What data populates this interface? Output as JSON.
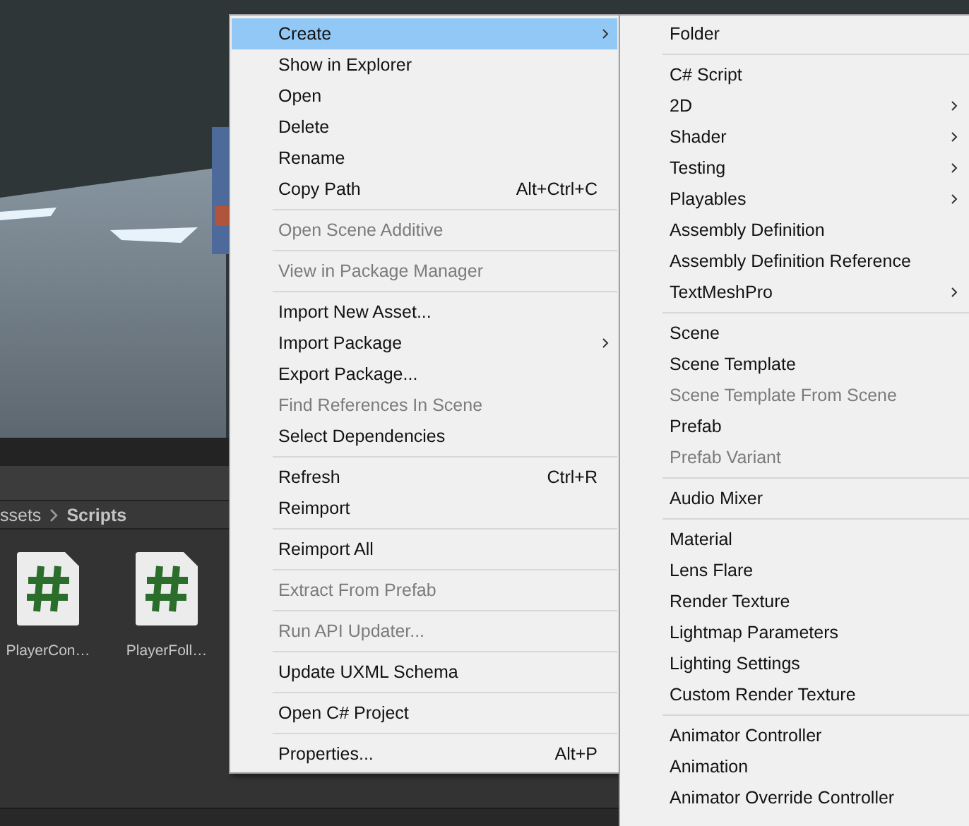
{
  "project_panel": {
    "breadcrumb": [
      {
        "label": "ssets",
        "current": false
      },
      {
        "label": "Scripts",
        "current": true
      }
    ],
    "files": [
      {
        "name": "PlayerCon…",
        "kind": "script"
      },
      {
        "name": "PlayerFoll…",
        "kind": "script"
      }
    ]
  },
  "context_menu": {
    "groups": [
      [
        {
          "label": "Create",
          "disabled": false,
          "submenu": true,
          "selected": true
        },
        {
          "label": "Show in Explorer",
          "disabled": false,
          "submenu": false,
          "selected": false
        },
        {
          "label": "Open",
          "disabled": false,
          "submenu": false,
          "selected": false
        },
        {
          "label": "Delete",
          "disabled": false,
          "submenu": false,
          "selected": false
        },
        {
          "label": "Rename",
          "disabled": false,
          "submenu": false,
          "selected": false
        },
        {
          "label": "Copy Path",
          "shortcut": "Alt+Ctrl+C",
          "disabled": false,
          "submenu": false,
          "selected": false
        }
      ],
      [
        {
          "label": "Open Scene Additive",
          "disabled": true,
          "submenu": false,
          "selected": false
        }
      ],
      [
        {
          "label": "View in Package Manager",
          "disabled": true,
          "submenu": false,
          "selected": false
        }
      ],
      [
        {
          "label": "Import New Asset...",
          "disabled": false,
          "submenu": false,
          "selected": false
        },
        {
          "label": "Import Package",
          "disabled": false,
          "submenu": true,
          "selected": false
        },
        {
          "label": "Export Package...",
          "disabled": false,
          "submenu": false,
          "selected": false
        },
        {
          "label": "Find References In Scene",
          "disabled": true,
          "submenu": false,
          "selected": false
        },
        {
          "label": "Select Dependencies",
          "disabled": false,
          "submenu": false,
          "selected": false
        }
      ],
      [
        {
          "label": "Refresh",
          "shortcut": "Ctrl+R",
          "disabled": false,
          "submenu": false,
          "selected": false
        },
        {
          "label": "Reimport",
          "disabled": false,
          "submenu": false,
          "selected": false
        }
      ],
      [
        {
          "label": "Reimport All",
          "disabled": false,
          "submenu": false,
          "selected": false
        }
      ],
      [
        {
          "label": "Extract From Prefab",
          "disabled": true,
          "submenu": false,
          "selected": false
        }
      ],
      [
        {
          "label": "Run API Updater...",
          "disabled": true,
          "submenu": false,
          "selected": false
        }
      ],
      [
        {
          "label": "Update UXML Schema",
          "disabled": false,
          "submenu": false,
          "selected": false
        }
      ],
      [
        {
          "label": "Open C# Project",
          "disabled": false,
          "submenu": false,
          "selected": false
        }
      ],
      [
        {
          "label": "Properties...",
          "shortcut": "Alt+P",
          "disabled": false,
          "submenu": false,
          "selected": false
        }
      ]
    ]
  },
  "create_submenu": {
    "groups": [
      [
        {
          "label": "Folder",
          "disabled": false,
          "submenu": false
        }
      ],
      [
        {
          "label": "C# Script",
          "disabled": false,
          "submenu": false
        },
        {
          "label": "2D",
          "disabled": false,
          "submenu": true
        },
        {
          "label": "Shader",
          "disabled": false,
          "submenu": true
        },
        {
          "label": "Testing",
          "disabled": false,
          "submenu": true
        },
        {
          "label": "Playables",
          "disabled": false,
          "submenu": true
        },
        {
          "label": "Assembly Definition",
          "disabled": false,
          "submenu": false
        },
        {
          "label": "Assembly Definition Reference",
          "disabled": false,
          "submenu": false
        },
        {
          "label": "TextMeshPro",
          "disabled": false,
          "submenu": true
        }
      ],
      [
        {
          "label": "Scene",
          "disabled": false,
          "submenu": false
        },
        {
          "label": "Scene Template",
          "disabled": false,
          "submenu": false
        },
        {
          "label": "Scene Template From Scene",
          "disabled": true,
          "submenu": false
        },
        {
          "label": "Prefab",
          "disabled": false,
          "submenu": false
        },
        {
          "label": "Prefab Variant",
          "disabled": true,
          "submenu": false
        }
      ],
      [
        {
          "label": "Audio Mixer",
          "disabled": false,
          "submenu": false
        }
      ],
      [
        {
          "label": "Material",
          "disabled": false,
          "submenu": false
        },
        {
          "label": "Lens Flare",
          "disabled": false,
          "submenu": false
        },
        {
          "label": "Render Texture",
          "disabled": false,
          "submenu": false
        },
        {
          "label": "Lightmap Parameters",
          "disabled": false,
          "submenu": false
        },
        {
          "label": "Lighting Settings",
          "disabled": false,
          "submenu": false
        },
        {
          "label": "Custom Render Texture",
          "disabled": false,
          "submenu": false
        }
      ],
      [
        {
          "label": "Animator Controller",
          "disabled": false,
          "submenu": false
        },
        {
          "label": "Animation",
          "disabled": false,
          "submenu": false
        },
        {
          "label": "Animator Override Controller",
          "disabled": false,
          "submenu": false
        }
      ]
    ]
  }
}
